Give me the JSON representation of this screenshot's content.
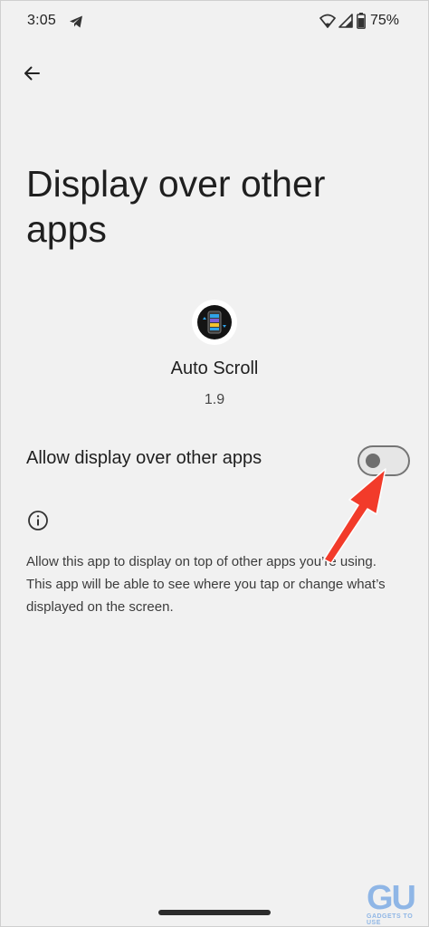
{
  "status_bar": {
    "time": "3:05",
    "battery": "75%",
    "icons": [
      "telegram-icon",
      "wifi-icon",
      "signal-icon",
      "battery-icon"
    ]
  },
  "header": {
    "back_icon": "arrow-left-icon",
    "title": "Display over other apps"
  },
  "app": {
    "name": "Auto Scroll",
    "version": "1.9",
    "icon": "auto-scroll-app-icon"
  },
  "setting": {
    "label": "Allow display over other apps",
    "enabled": false
  },
  "info": {
    "icon": "info-icon",
    "text": "Allow this app to display on top of other apps you’re using. This app will be able to see where you tap or change what’s displayed on the screen."
  },
  "annotation": {
    "color": "#f23b2a",
    "icon": "red-arrow-annotation"
  },
  "watermark": {
    "letters": "GU",
    "text": "GADGETS TO USE",
    "color": "#8fb6e6"
  }
}
